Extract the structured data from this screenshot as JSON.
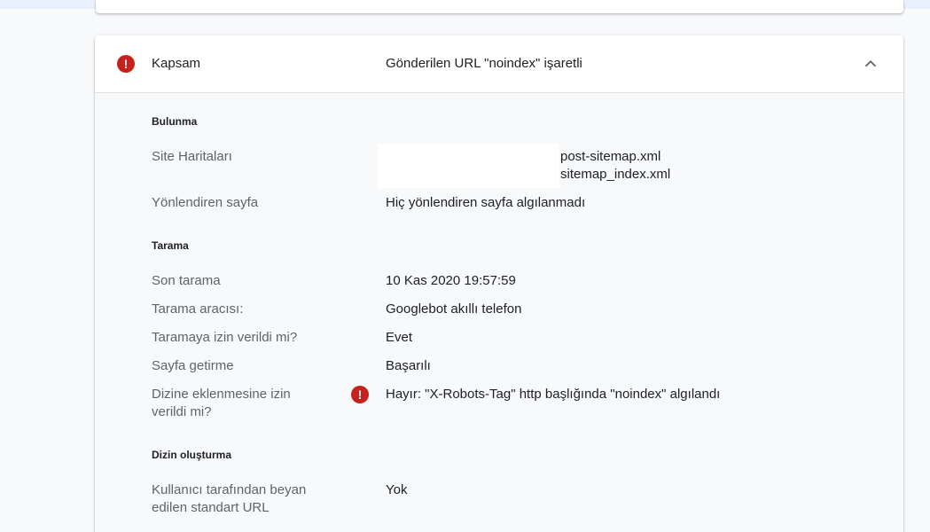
{
  "header": {
    "label": "Kapsam",
    "value": "Gönderilen URL \"noindex\" işaretli",
    "status_icon": "error-icon",
    "toggle_icon": "chevron-up-icon"
  },
  "colors": {
    "error": "#c5221f",
    "label_text": "#5f6368",
    "value_text": "#202124"
  },
  "sections": {
    "discovery": {
      "title": "Bulunma",
      "sitemaps_label": "Site Haritaları",
      "sitemaps": [
        "post-sitemap.xml",
        "sitemap_index.xml"
      ],
      "referring_label": "Yönlendiren sayfa",
      "referring_value": "Hiç yönlendiren sayfa algılanmadı"
    },
    "crawl": {
      "title": "Tarama",
      "last_crawl_label": "Son tarama",
      "last_crawl_value": "10 Kas 2020 19:57:59",
      "crawled_as_label": "Tarama aracısı:",
      "crawled_as_value": "Googlebot akıllı telefon",
      "crawl_allowed_label": "Taramaya izin verildi mi?",
      "crawl_allowed_value": "Evet",
      "fetch_label": "Sayfa getirme",
      "fetch_value": "Başarılı",
      "indexing_allowed_label": "Dizine eklenmesine izin verildi mi?",
      "indexing_allowed_value": "Hayır: \"X-Robots-Tag\" http başlığında \"noindex\" algılandı"
    },
    "indexing": {
      "title": "Dizin oluşturma",
      "user_canonical_label": "Kullanıcı tarafından beyan edilen standart URL",
      "user_canonical_value": "Yok"
    }
  }
}
